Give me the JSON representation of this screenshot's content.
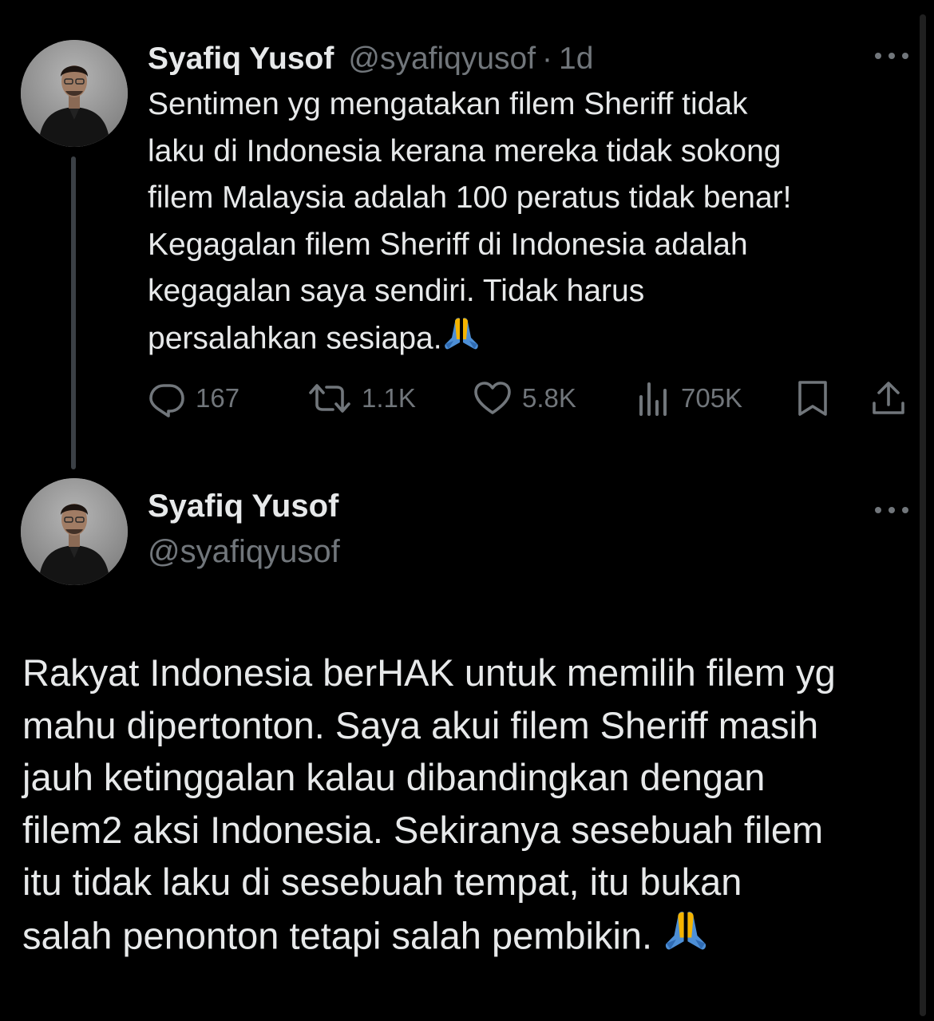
{
  "colors": {
    "background": "#000000",
    "primary_text": "#e7e9ea",
    "secondary_text": "#71767b",
    "thread_line": "#3b4045"
  },
  "tweet1": {
    "name": "Syafiq Yusof",
    "handle": "@syafiqyusof",
    "separator": "·",
    "time": "1d",
    "text": "Sentimen yg mengatakan filem Sheriff tidak\nlaku di Indonesia kerana mereka tidak sokong\nfilem Malaysia adalah 100 peratus tidak benar!\nKegagalan filem Sheriff di Indonesia adalah\nkegagalan saya sendiri. Tidak harus\npersalahkan sesiapa.",
    "emoji": "folded-hands",
    "actions": {
      "replies": "167",
      "retweets": "1.1K",
      "likes": "5.8K",
      "views": "705K"
    },
    "icons": [
      "reply-icon",
      "retweet-icon",
      "like-icon",
      "views-icon",
      "bookmark-icon",
      "share-icon",
      "more-icon"
    ]
  },
  "tweet2": {
    "name": "Syafiq Yusof",
    "handle": "@syafiqyusof",
    "text": "Rakyat Indonesia berHAK untuk memilih filem yg\nmahu dipertonton. Saya akui filem Sheriff masih\njauh ketinggalan kalau dibandingkan dengan\nfilem2 aksi Indonesia. Sekiranya sesebuah filem\nitu tidak laku di sesebuah tempat, itu bukan\nsalah penonton tetapi salah pembikin. ",
    "emoji": "folded-hands"
  }
}
